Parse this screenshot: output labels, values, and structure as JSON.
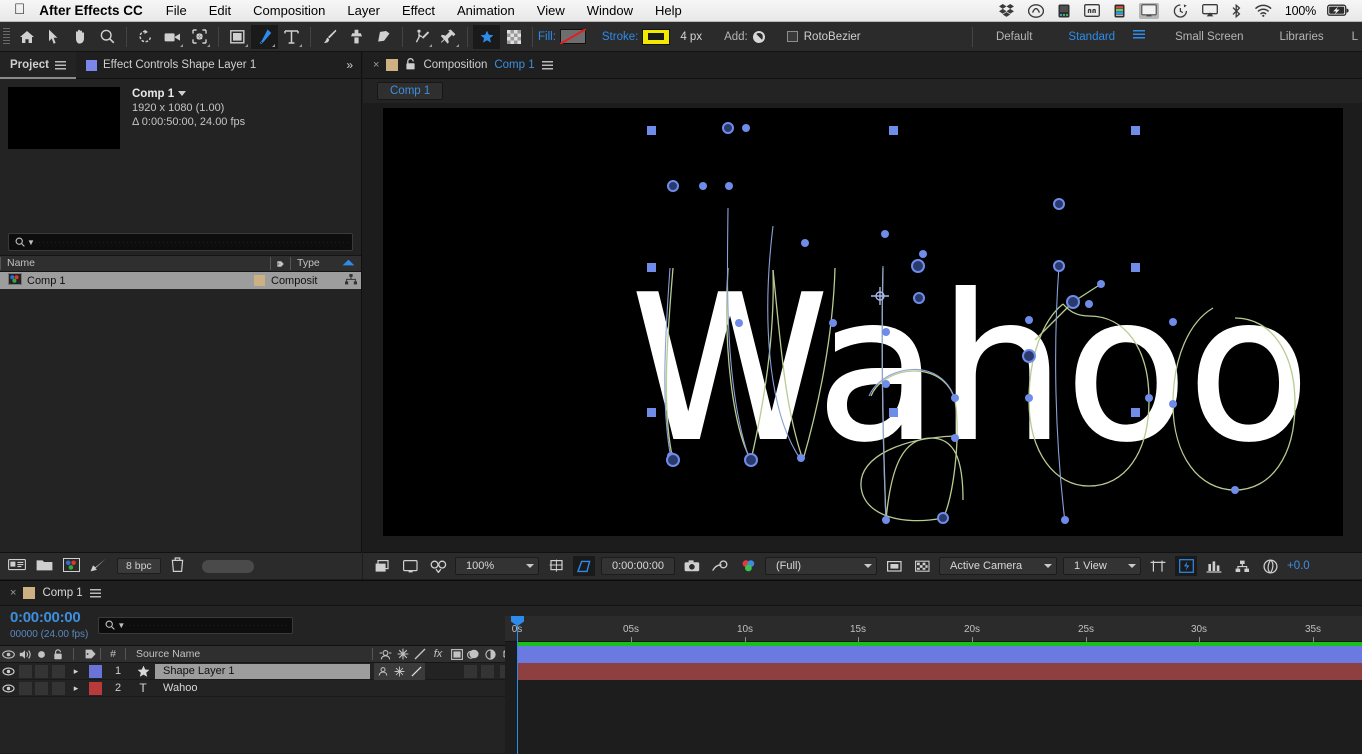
{
  "menubar": {
    "apple": "",
    "app": "After Effects CC",
    "items": [
      "File",
      "Edit",
      "Composition",
      "Layer",
      "Effect",
      "Animation",
      "View",
      "Window",
      "Help"
    ],
    "status_icons": [
      "dropbox-icon",
      "creative-cloud-icon",
      "battery-app-icon",
      "display-mirror-icon",
      "color-meter-icon",
      "screen-icon",
      "time-machine-icon",
      "airplay-icon",
      "bluetooth-icon",
      "wifi-icon"
    ],
    "battery_percent": "100%",
    "battery_icon": "battery-charging-icon"
  },
  "toolbar": {
    "tools": [
      "home-icon",
      "selection-arrow-icon",
      "hand-icon",
      "zoom-icon",
      "rotation-icon",
      "camera-icon",
      "pan-behind-icon",
      "rectangle-icon",
      "pen-icon",
      "type-icon",
      "brush-icon",
      "clone-stamp-icon",
      "eraser-icon",
      "roto-brush-icon",
      "puppet-pin-icon"
    ],
    "active_tool": "pen-icon",
    "snapping_icon": "snap-star-icon",
    "alpha_icon": "checkerboard-icon",
    "fill_label": "Fill:",
    "fill_value": "none",
    "stroke_label": "Stroke:",
    "stroke_color": "#f2e800",
    "stroke_width": "4 px",
    "add_label": "Add:",
    "rotobezier_label": "RotoBezier",
    "rotobezier_checked": false,
    "workspaces": [
      "Default",
      "Standard",
      "Small Screen",
      "Libraries",
      "L"
    ],
    "active_workspace": "Standard"
  },
  "project_panel": {
    "tabs": [
      {
        "label": "Project",
        "active": true,
        "icon": "hamburger-icon"
      },
      {
        "label": "Effect Controls Shape Layer 1",
        "active": false,
        "icon": "blue-square-icon"
      }
    ],
    "expand_label": "»",
    "comp_name": "Comp 1",
    "comp_resolution": "1920 x 1080 (1.00)",
    "comp_duration": "Δ 0:00:50:00, 24.00 fps",
    "search_placeholder": "",
    "columns": [
      "Name",
      "Type"
    ],
    "tag_column_icon": "tag-icon",
    "sort_icon": "sort-ascending-icon",
    "assets": [
      {
        "name": "Comp 1",
        "type": "Composit",
        "icon": "composition-icon",
        "color": "#cdb183",
        "selected": true
      }
    ],
    "footer": {
      "icons": [
        "interpret-footage-icon",
        "new-folder-icon",
        "new-composition-icon",
        "project-settings-icon",
        "delete-icon"
      ],
      "bit_depth": "8 bpc"
    }
  },
  "composition_panel": {
    "close_label": "×",
    "lock_icon": "lock-icon",
    "menu_icon": "hamburger-icon",
    "title_prefix": "Composition",
    "title_name": "Comp 1",
    "breadcrumb": "Comp 1",
    "artwork_text": "Wahoo",
    "bottom_bar": {
      "region_icon": "region-of-interest-icon",
      "transparency_icon": "transparency-grid-icon",
      "mask_icon": "mask-view-icon",
      "zoom": "100%",
      "time": "0:00:00:00",
      "snapshot_icon": "camera-icon",
      "show_snapshot_icon": "show-snapshot-icon",
      "channel_icon": "rgb-channels-icon",
      "resolution": "(Full)",
      "roi_icon": "region-icon",
      "grid_icon": "grid-icon",
      "camera": "Active Camera",
      "views": "1 View",
      "pixel_aspect_icon": "pixel-aspect-icon",
      "fast_preview_icon": "fast-preview-icon",
      "timeline_icon": "timeline-icon",
      "flowchart_icon": "flowchart-icon",
      "exposure_icon": "exposure-icon",
      "exposure_value": "+0.0"
    }
  },
  "timeline_panel": {
    "close_label": "×",
    "tab_label": "Comp 1",
    "menu_icon": "hamburger-icon",
    "current_time": "0:00:00:00",
    "frame_info": "00000 (24.00 fps)",
    "search_placeholder": "",
    "toolbar_icons": [
      "composition-mini-flowchart-icon",
      "draft-3d-icon",
      "motion-blur-icon",
      "frame-blending-icon",
      "brainstorm-icon",
      "graph-editor-icon"
    ],
    "columns": {
      "video_icon": "eye-icon",
      "audio_icon": "speaker-icon",
      "solo_icon": "solo-icon",
      "lock_icon": "lock-icon",
      "label_icon": "tag-icon",
      "number": "#",
      "source_name": "Source Name",
      "switches": [
        "shy-icon",
        "collapse-icon",
        "quality-icon",
        "effects-icon",
        "frame-blend-icon",
        "motion-blur-icon",
        "adjustment-icon",
        "3d-layer-icon"
      ]
    },
    "layers": [
      {
        "index": "1",
        "name": "Shape Layer 1",
        "type_icon": "shape-star-icon",
        "color": "#6a74d8",
        "bar_color": "#6a7ae0",
        "selected": true
      },
      {
        "index": "2",
        "name": "Wahoo",
        "type_icon": "text-T-icon",
        "color": "#b83a3a",
        "bar_color": "#8e4040",
        "selected": false
      }
    ],
    "ruler_ticks": [
      "0s",
      "05s",
      "10s",
      "15s",
      "20s",
      "25s",
      "30s",
      "35s"
    ],
    "playhead_time": "0s"
  },
  "colors": {
    "accent_blue": "#2d8ceb",
    "stroke_yellow": "#f2e800",
    "path_green": "#b5c98f",
    "vertex_blue": "#6e8ce8",
    "render_green": "#1bbf1b"
  }
}
